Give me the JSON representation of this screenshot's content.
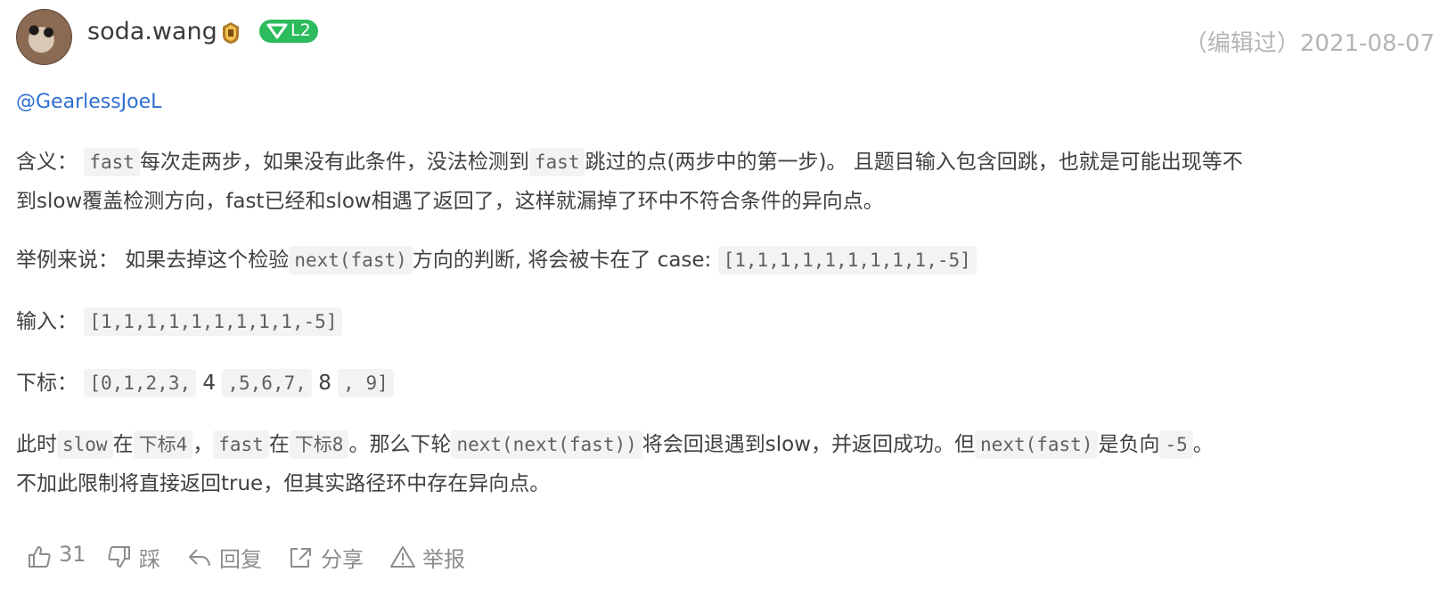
{
  "header": {
    "username": "soda.wang",
    "level": "L2",
    "edited_meta": "（编辑过）2021-08-07"
  },
  "comment": {
    "mention": "@GearlessJoeL",
    "p1": {
      "lead": "含义：",
      "code1": "fast",
      "t1": "每次走两步，如果没有此条件，没法检测到",
      "code2": "fast",
      "t2": "跳过的点(两步中的第一步)。 且题目输入包含回跳，也就是可能出现等不",
      "line2": "到slow覆盖检测方向，fast已经和slow相遇了返回了，这样就漏掉了环中不符合条件的异向点。"
    },
    "p2": {
      "lead": "举例来说： 如果去掉这个检验",
      "code1": "next(fast)",
      "t1": "方向的判断, 将会被卡在了 case:",
      "code2": "[1,1,1,1,1,1,1,1,1,-5]"
    },
    "p3": {
      "lead": "输入：",
      "code1": "[1,1,1,1,1,1,1,1,1,-5]"
    },
    "p4": {
      "lead": "下标：",
      "code1": "[0,1,2,3,",
      "t1": "4",
      "code2": ",5,6,7,",
      "t2": "8",
      "code3": ", 9]"
    },
    "p5": {
      "t0": "此时",
      "code1": "slow",
      "t1": "在",
      "code2": "下标4",
      "t2": "，",
      "code3": "fast",
      "t3": "在",
      "code4": "下标8",
      "t4": "。那么下轮",
      "code5": "next(next(fast))",
      "t5": "将会回退遇到slow，并返回成功。但",
      "code6": "next(fast)",
      "t6": "是负向",
      "code7": "-5",
      "t7": "。",
      "line2": "不加此限制将直接返回true，但其实路径环中存在异向点。"
    }
  },
  "actions": {
    "like_count": "31",
    "dislike_label": "踩",
    "reply_label": "回复",
    "share_label": "分享",
    "report_label": "举报"
  },
  "icons": [
    "thumbs-up-icon",
    "thumbs-down-icon",
    "reply-icon",
    "share-icon",
    "warning-icon",
    "medal-icon",
    "gem-icon"
  ],
  "colors": {
    "level_badge": "#2cbb5d",
    "mention": "#2f6fcf",
    "meta": "#b5b5b5"
  }
}
